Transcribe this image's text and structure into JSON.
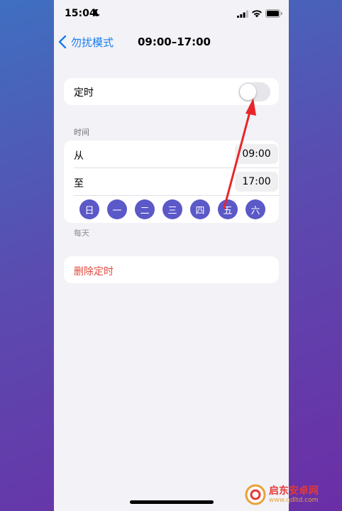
{
  "status_bar": {
    "time": "15:04",
    "icons": [
      "moon-icon",
      "cellular-signal-icon",
      "wifi-icon",
      "battery-icon"
    ]
  },
  "nav": {
    "back_label": "勿扰模式",
    "title": "09:00–17:00"
  },
  "schedule": {
    "label": "定时",
    "enabled": false
  },
  "time_section": {
    "header": "时间",
    "from_label": "从",
    "from_value": "09:00",
    "to_label": "至",
    "to_value": "17:00",
    "days": [
      "日",
      "一",
      "二",
      "三",
      "四",
      "五",
      "六"
    ],
    "footnote": "每天"
  },
  "delete": {
    "label": "删除定时"
  },
  "watermark": {
    "name": "启东安卓网",
    "url": "www.qdltd.com"
  },
  "colors": {
    "accent": "#1a7cf0",
    "day_active": "#5b58c8",
    "destructive": "#e1493e",
    "annotation_arrow": "#e8262a"
  }
}
